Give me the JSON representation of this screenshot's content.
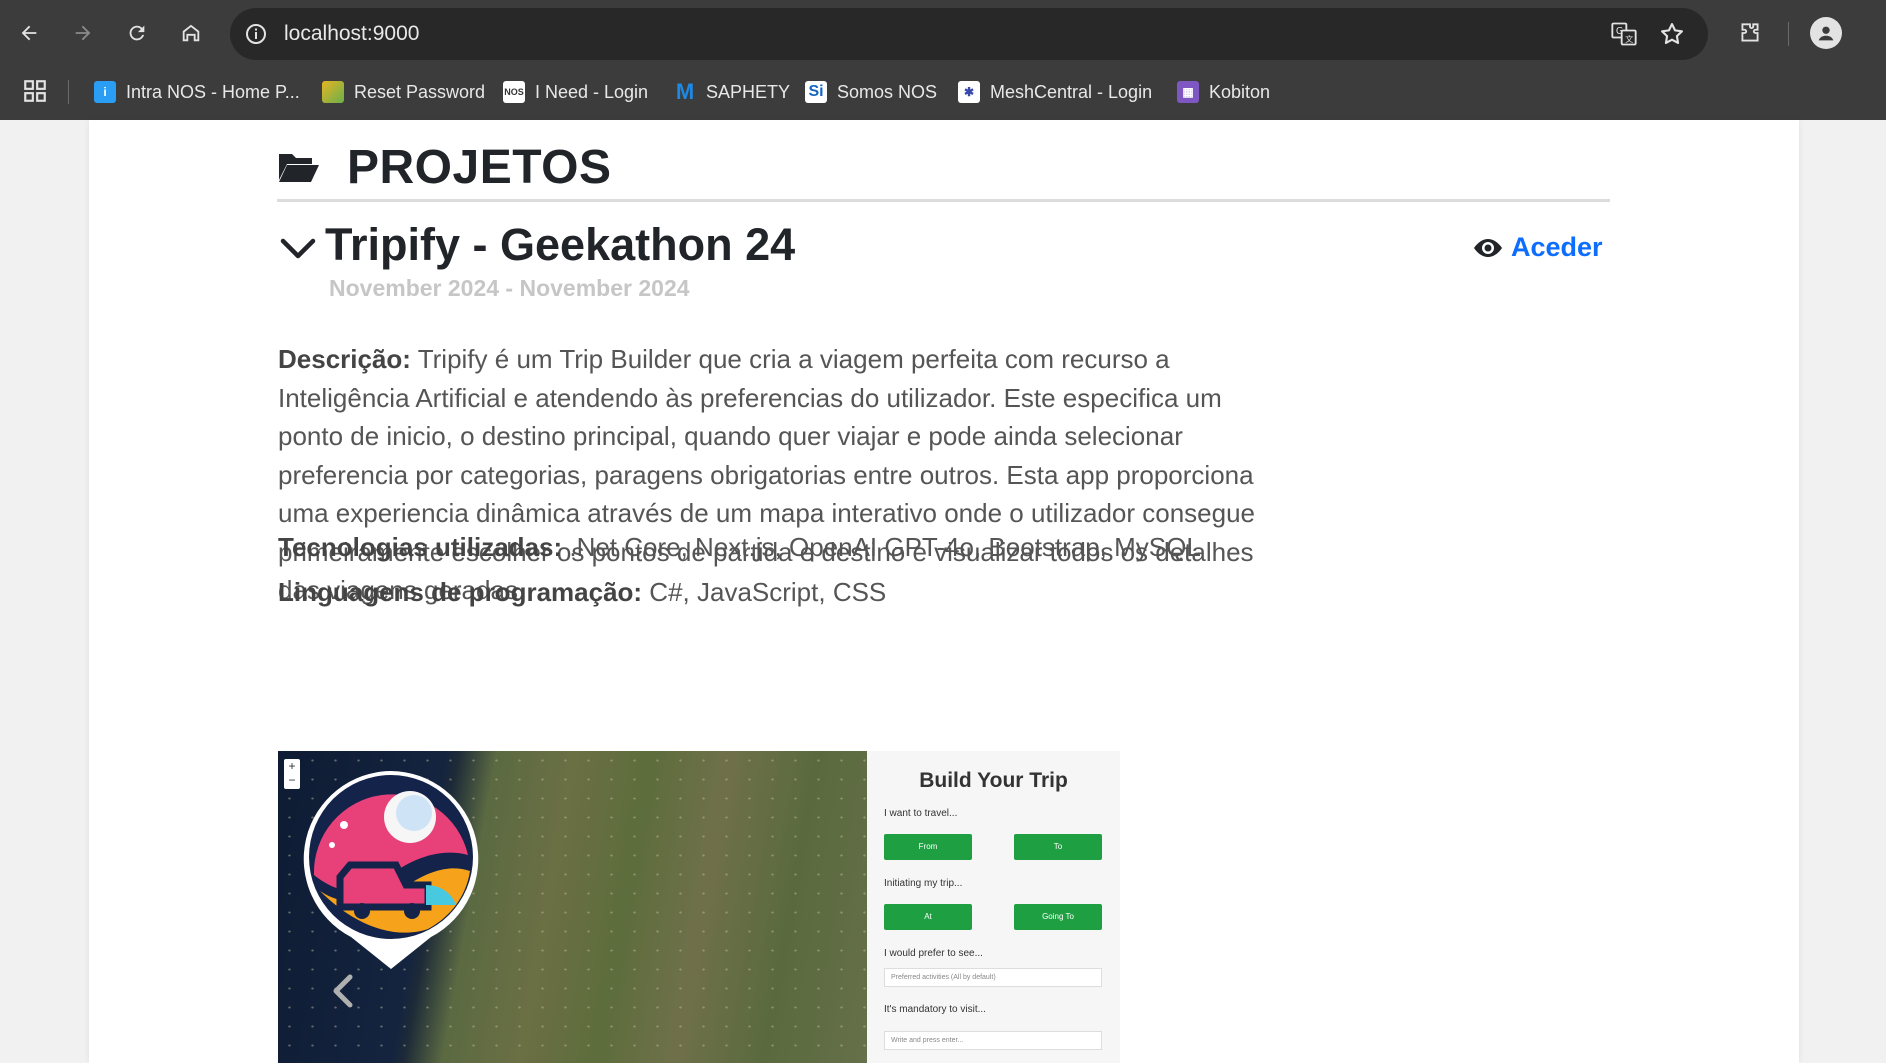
{
  "browser": {
    "url": "localhost:9000",
    "bookmarks": [
      {
        "label": "Intra NOS - Home P...",
        "icon": "intra-nos-icon",
        "color": "#2a9df4"
      },
      {
        "label": "Reset Password",
        "icon": "reset-password-icon",
        "color": "#e6b422"
      },
      {
        "label": "I Need - Login",
        "icon": "nos-icon",
        "color": "#ffffff"
      },
      {
        "label": "SAPHETY",
        "icon": "saphety-icon",
        "color": "#1e88e5"
      },
      {
        "label": "Somos NOS",
        "icon": "somos-nos-icon",
        "color": "#1565c0"
      },
      {
        "label": "MeshCentral - Login",
        "icon": "meshcentral-icon",
        "color": "#3949ab"
      },
      {
        "label": "Kobiton",
        "icon": "kobiton-icon",
        "color": "#7e57c2"
      }
    ]
  },
  "section": {
    "title": "PROJETOS"
  },
  "project": {
    "title": "Tripify - Geekathon 24",
    "date": "November 2024 - November 2024",
    "access_label": "Aceder",
    "description_label": "Descrição:",
    "description": " Tripify é um Trip Builder que cria a viagem perfeita com recurso a Inteligência Artificial e atendendo às preferencias do utilizador. Este especifica um ponto de inicio, o destino principal, quando quer viajar e pode ainda selecionar preferencia por categorias, paragens obrigatorias entre outros. Esta app proporciona uma experiencia dinâmica através de um mapa interativo onde o utilizador consegue primeiramente escolher os pontos de partida e destino e visualizar todos os detalhes das viagens geradas.",
    "tech_label": "Tecnologias utilizadas:",
    "tech": " .Net Core, Next.js, OpenAI GPT-4o, Bootstrap, MySQL",
    "lang_label": "Linguagens de programação:",
    "lang": " C#, JavaScript, CSS"
  },
  "screenshot": {
    "zoom_in": "+",
    "zoom_out": "−",
    "panel_title": "Build Your Trip",
    "label_travel": "I want to travel...",
    "btn_from": "From",
    "btn_to": "To",
    "label_initiating": "Initiating my trip...",
    "btn_at": "At",
    "btn_going": "Going To",
    "label_prefer": "I would prefer to see...",
    "select_placeholder": "Preferred activities (All by default)",
    "label_mandatory": "It's mandatory to visit...",
    "input_placeholder": "Write and press enter..."
  },
  "colors": {
    "accent": "#0d6efd",
    "green": "#1e9f41"
  }
}
